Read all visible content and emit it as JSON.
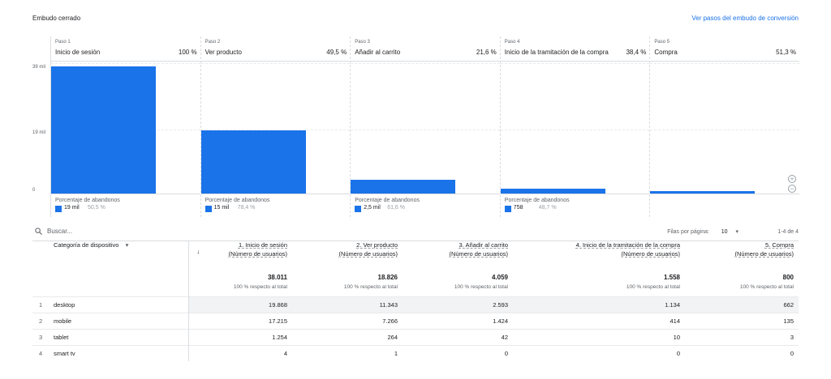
{
  "header": {
    "title": "Embudo cerrado",
    "link": "Ver pasos del embudo de conversión"
  },
  "funnel": {
    "y_ticks": [
      "39 mil",
      "19 mil",
      "0"
    ],
    "abandon_label": "Porcentaje de abandonos",
    "steps": [
      {
        "num": "Paso 1",
        "name": "Inicio de sesión",
        "pct": "100 %",
        "users": 38011,
        "aband_val": "19 mil",
        "aband_pct": "50,5 %"
      },
      {
        "num": "Paso 2",
        "name": "Ver producto",
        "pct": "49,5 %",
        "users": 18826,
        "aband_val": "15 mil",
        "aband_pct": "78,4 %"
      },
      {
        "num": "Paso 3",
        "name": "Añadir al carrito",
        "pct": "21,6 %",
        "users": 4059,
        "aband_val": "2,5 mil",
        "aband_pct": "61,6 %"
      },
      {
        "num": "Paso 4",
        "name": "Inicio de la tramitación de la compra",
        "pct": "38,4 %",
        "users": 1558,
        "aband_val": "758",
        "aband_pct": "48,7 %"
      },
      {
        "num": "Paso 5",
        "name": "Compra",
        "pct": "51,3 %",
        "users": 800,
        "aband_val": "",
        "aband_pct": ""
      }
    ],
    "y_max": 39000,
    "colors": {
      "bar": "#1a73e8",
      "link": "#1a73e8"
    }
  },
  "search": {
    "placeholder": "Buscar..."
  },
  "pagination": {
    "rows_label": "Filas por página:",
    "rows_value": "10",
    "range": "1-4 de 4"
  },
  "table": {
    "dimension_header": "Categoría de dispositivo",
    "metric_sub": "(Número de usuarios)",
    "metric_headers": [
      "1. Inicio de sesión",
      "2. Ver producto",
      "3. Añadir al carrito",
      "4. Inicio de la tramitación de la compra",
      "5. Compra"
    ],
    "totals": [
      "38.011",
      "18.826",
      "4.059",
      "1.558",
      "800"
    ],
    "totals_sub": "100 % respecto al total",
    "rows": [
      {
        "idx": "1",
        "dim": "desktop",
        "vals": [
          "19.868",
          "11.343",
          "2.593",
          "1.134",
          "662"
        ]
      },
      {
        "idx": "2",
        "dim": "mobile",
        "vals": [
          "17.215",
          "7.266",
          "1.424",
          "414",
          "135"
        ]
      },
      {
        "idx": "3",
        "dim": "tablet",
        "vals": [
          "1.254",
          "264",
          "42",
          "10",
          "3"
        ]
      },
      {
        "idx": "4",
        "dim": "smart tv",
        "vals": [
          "4",
          "1",
          "0",
          "0",
          "0"
        ]
      }
    ]
  }
}
